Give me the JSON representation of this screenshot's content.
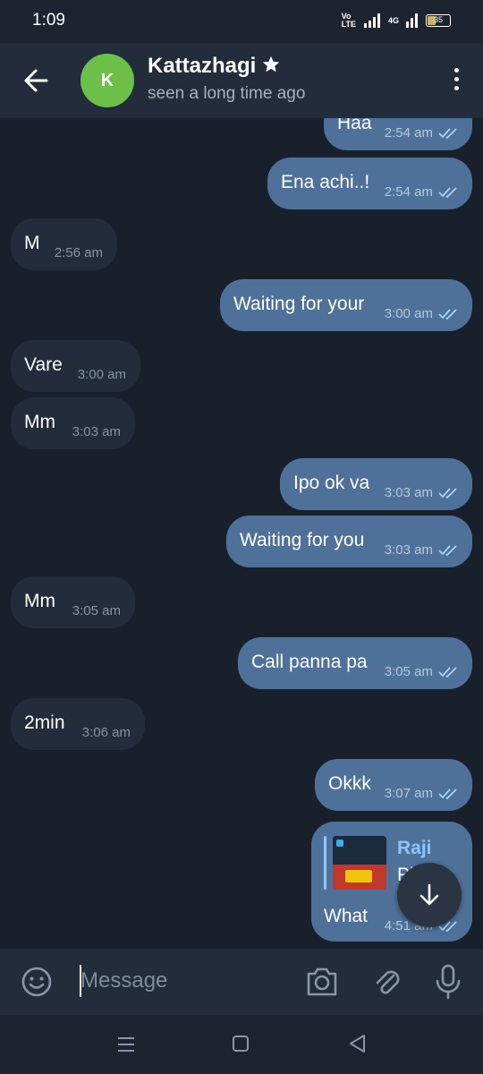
{
  "status_bar": {
    "time": "1:09",
    "volte": "Vo LTE",
    "network": "4G",
    "battery": "35"
  },
  "header": {
    "avatar_letter": "K",
    "name": "Kattazhagi",
    "status": "seen a long time ago"
  },
  "messages": [
    {
      "dir": "out",
      "text": "Haa",
      "time": "2:54 am"
    },
    {
      "dir": "out",
      "text": "Ena achi..!",
      "time": "2:54 am"
    },
    {
      "dir": "in",
      "text": "M",
      "time": "2:56 am"
    },
    {
      "dir": "out",
      "text": "Waiting for your",
      "time": "3:00 am"
    },
    {
      "dir": "in",
      "text": "Vare",
      "time": "3:00 am"
    },
    {
      "dir": "in",
      "text": "Mm",
      "time": "3:03 am"
    },
    {
      "dir": "out",
      "text": "Ipo ok va",
      "time": "3:03 am"
    },
    {
      "dir": "out",
      "text": "Waiting for you",
      "time": "3:03 am"
    },
    {
      "dir": "in",
      "text": "Mm",
      "time": "3:05 am"
    },
    {
      "dir": "out",
      "text": "Call panna pa",
      "time": "3:05 am"
    },
    {
      "dir": "in",
      "text": "2min",
      "time": "3:06 am"
    },
    {
      "dir": "out",
      "text": "Okkk",
      "time": "3:07 am"
    }
  ],
  "reply_message": {
    "sender": "Raji",
    "snippet": "Pl",
    "text": "What",
    "time": "4:51 am"
  },
  "input": {
    "placeholder": "Message"
  },
  "colors": {
    "accent": "#4f7199",
    "incoming": "#222c3a",
    "avatar": "#6cc04a",
    "reply_name": "#8fc5ff"
  }
}
